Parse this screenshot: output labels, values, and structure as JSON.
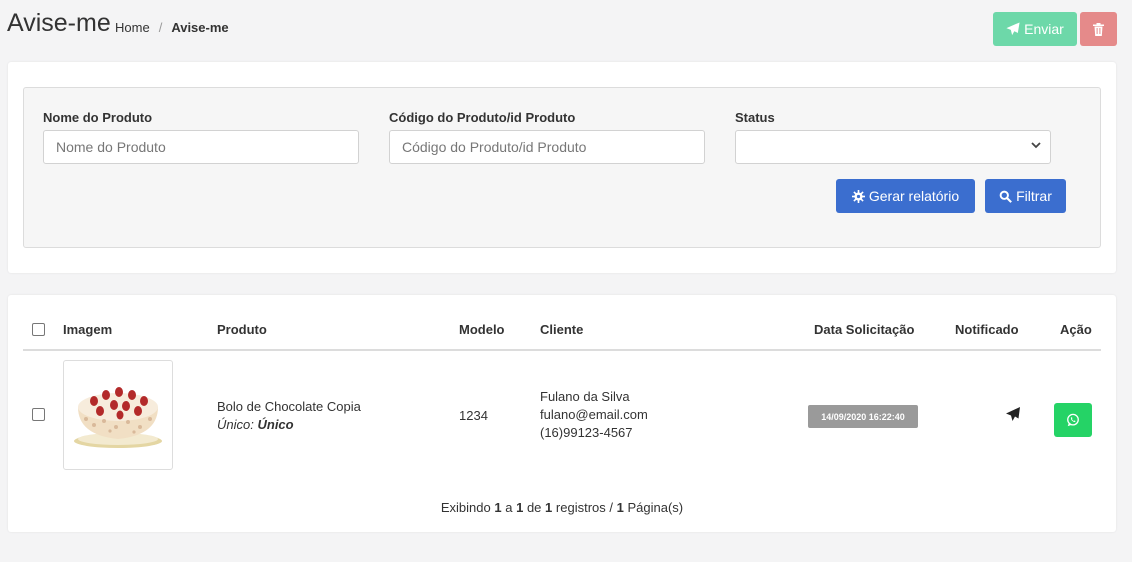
{
  "header": {
    "title": "Avise-me",
    "breadcrumb": {
      "home": "Home",
      "separator": "/",
      "current": "Avise-me"
    },
    "send_label": "Enviar",
    "send_color": "#6dd8a9",
    "delete_color": "#e58a8a"
  },
  "filters": {
    "product_name": {
      "label": "Nome do Produto",
      "placeholder": "Nome do Produto",
      "value": ""
    },
    "product_code": {
      "label": "Código do Produto/id Produto",
      "placeholder": "Código do Produto/id Produto",
      "value": ""
    },
    "status": {
      "label": "Status",
      "selected": ""
    },
    "report_label": "Gerar relatório",
    "filter_label": "Filtrar",
    "button_color": "#3b6ecf"
  },
  "table": {
    "columns": {
      "image": "Imagem",
      "product": "Produto",
      "model": "Modelo",
      "client": "Cliente",
      "date": "Data Solicitação",
      "notified": "Notificado",
      "action": "Ação"
    },
    "rows": [
      {
        "image_icon": "cake-image",
        "product_name": "Bolo de Chocolate Copia",
        "variant_label": "Único:",
        "variant_value": "Único",
        "model": "1234",
        "client_name": "Fulano da Silva",
        "client_email": "fulano@email.com",
        "client_phone": "(16)99123-4567",
        "date": "14/09/2020 16:22:40",
        "notified_icon": "paper-plane-icon",
        "action_icon": "whatsapp-icon",
        "action_color": "#25d366"
      }
    ]
  },
  "pagination": {
    "prefix": "Exibindo",
    "from": "1",
    "a": "a",
    "to": "1",
    "de": "de",
    "total": "1",
    "registros": "registros /",
    "pages": "1",
    "pages_label": "Página(s)"
  }
}
